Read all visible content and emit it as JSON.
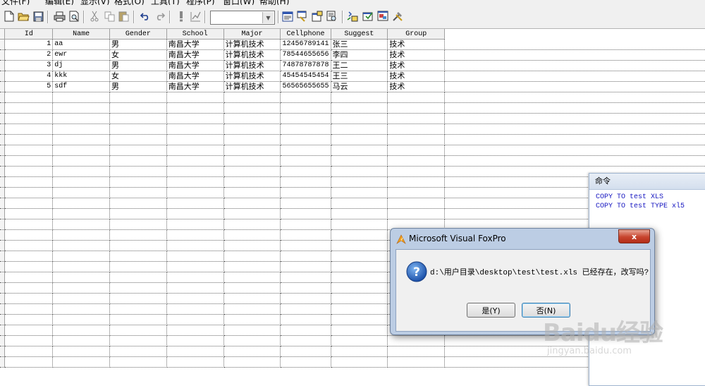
{
  "menu": [
    "文件(F)",
    "编辑(E)",
    "显示(V)",
    "格式(O)",
    "工具(T)",
    "程序(P)",
    "窗口(W)",
    "帮助(H)"
  ],
  "toolbar": {
    "icons": [
      "new-file-icon",
      "open-folder-icon",
      "save-icon",
      "print-icon",
      "print-preview-icon",
      "cut-icon",
      "copy-icon",
      "paste-icon",
      "undo-icon",
      "redo-icon",
      "run-icon",
      "modify-form-icon",
      "command-window-icon",
      "data-session-icon",
      "properties-icon",
      "code-window-icon",
      "form-designer-icon",
      "class-browser-icon",
      "component-gallery-icon",
      "coverage-icon"
    ],
    "combo_value": ""
  },
  "table": {
    "columns": [
      "Id",
      "Name",
      "Gender",
      "School",
      "Major",
      "Cellphone",
      "Suggest",
      "Group"
    ],
    "rows": [
      [
        "1",
        "aa",
        "男",
        "南昌大学",
        "计算机技术",
        "12456789141",
        "张三",
        "技术"
      ],
      [
        "2",
        "ewr",
        "女",
        "南昌大学",
        "计算机技术",
        "78544655656",
        "李四",
        "技术"
      ],
      [
        "3",
        "dj",
        "男",
        "南昌大学",
        "计算机技术",
        "74878787878",
        "王二",
        "技术"
      ],
      [
        "4",
        "kkk",
        "女",
        "南昌大学",
        "计算机技术",
        "45454545454",
        "王三",
        "技术"
      ],
      [
        "5",
        "sdf",
        "男",
        "南昌大学",
        "计算机技术",
        "56565655655",
        "马云",
        "技术"
      ]
    ]
  },
  "command_window": {
    "title": "命令",
    "lines": [
      "COPY TO test XLS",
      "COPY TO test TYPE xl5"
    ]
  },
  "dialog": {
    "title": "Microsoft Visual FoxPro",
    "message": "d:\\用户目录\\desktop\\test\\test.xls 已经存在，改写吗?",
    "yes_label": "是(Y)",
    "no_label": "否(N)",
    "close_label": "x"
  },
  "watermark": {
    "text": "Baidu经验",
    "url": "jingyan.baidu.com"
  }
}
